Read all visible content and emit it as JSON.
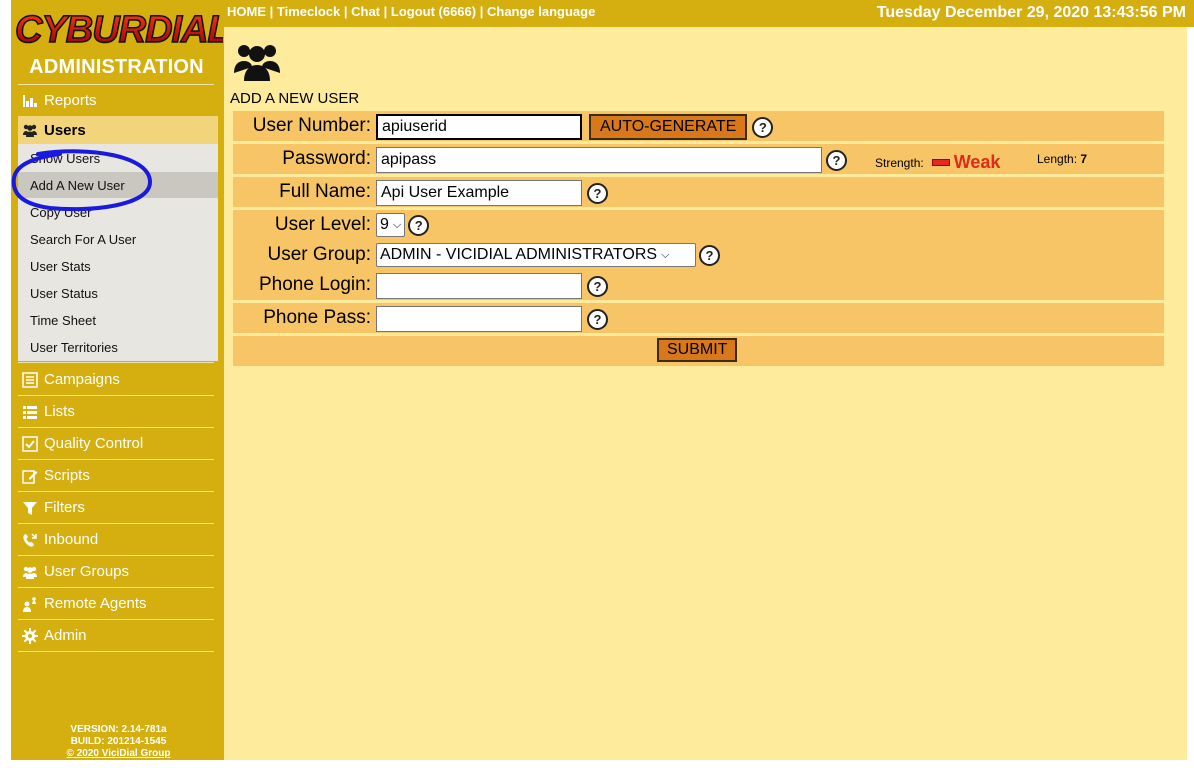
{
  "brand": {
    "logo_text": "CYBURDIAL",
    "admin_title": "ADMINISTRATION"
  },
  "topbar": {
    "nav": [
      "HOME",
      "Timeclock",
      "Chat",
      "Logout (6666)",
      "Change language"
    ],
    "separator": " | ",
    "datetime": "Tuesday December 29, 2020 13:43:56 PM"
  },
  "sidebar": {
    "reports": {
      "label": "Reports",
      "icon": "reports-icon"
    },
    "users": {
      "label": "Users",
      "icon": "users-icon",
      "items": [
        "Show Users",
        "Add A New User",
        "Copy User",
        "Search For A User",
        "User Stats",
        "User Status",
        "Time Sheet",
        "User Territories"
      ],
      "active": "Add A New User"
    },
    "sections": [
      {
        "label": "Campaigns",
        "icon": "campaigns-icon"
      },
      {
        "label": "Lists",
        "icon": "lists-icon"
      },
      {
        "label": "Quality Control",
        "icon": "quality-control-icon"
      },
      {
        "label": "Scripts",
        "icon": "scripts-icon"
      },
      {
        "label": "Filters",
        "icon": "filter-icon"
      },
      {
        "label": "Inbound",
        "icon": "inbound-phone-icon"
      },
      {
        "label": "User Groups",
        "icon": "user-groups-icon"
      },
      {
        "label": "Remote Agents",
        "icon": "remote-agents-icon"
      },
      {
        "label": "Admin",
        "icon": "gear-icon"
      }
    ],
    "version": {
      "version": "VERSION: 2.14-781a",
      "build": "BUILD: 201214-1545",
      "copyright": "© 2020 ViciDial Group"
    }
  },
  "main": {
    "page_title": "ADD A NEW USER",
    "form": {
      "user_number": {
        "label": "User Number:",
        "value": "apiuserid",
        "button": "AUTO-GENERATE"
      },
      "password": {
        "label": "Password:",
        "value": "apipass",
        "strength_label": "Strength:",
        "strength_value": "Weak",
        "length_label": "Length:",
        "length_value": "7"
      },
      "full_name": {
        "label": "Full Name:",
        "value": "Api User Example"
      },
      "user_level": {
        "label": "User Level:",
        "value": "9"
      },
      "user_group": {
        "label": "User Group:",
        "value": "ADMIN - VICIDIAL ADMINISTRATORS"
      },
      "phone_login": {
        "label": "Phone Login:",
        "value": ""
      },
      "phone_pass": {
        "label": "Phone Pass:",
        "value": ""
      },
      "submit": "SUBMIT"
    }
  },
  "colors": {
    "sidebar": "#d4af0f",
    "main_bg": "#ffeb9c",
    "row_bg": "#f7c566",
    "button": "#d9781b",
    "weak": "#e02a1c",
    "annotation": "#1a1adf"
  }
}
